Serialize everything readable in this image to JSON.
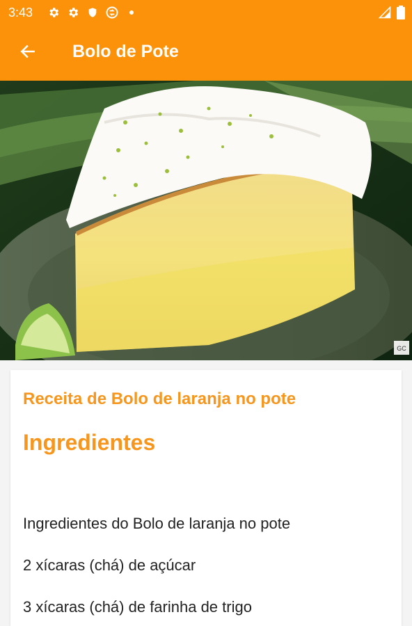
{
  "status_bar": {
    "time": "3:43",
    "icons_left": [
      "gear-icon",
      "gear-icon",
      "shield-icon",
      "sync-icon",
      "dot-icon"
    ],
    "icons_right": [
      "signal-icon",
      "battery-icon"
    ]
  },
  "app_bar": {
    "back_icon": "arrow-left-icon",
    "title": "Bolo de Pote"
  },
  "hero": {
    "watermark": "GC"
  },
  "content": {
    "recipe_title": "Receita de Bolo de laranja no pote",
    "section_heading": "Ingredientes",
    "ingredients": [
      "Ingredientes do Bolo de laranja no pote",
      "2 xícaras (chá) de açúcar",
      "3 xícaras (chá) de farinha de trigo"
    ]
  },
  "colors": {
    "primary": "#fb9209",
    "accent_text": "#f7961d"
  }
}
